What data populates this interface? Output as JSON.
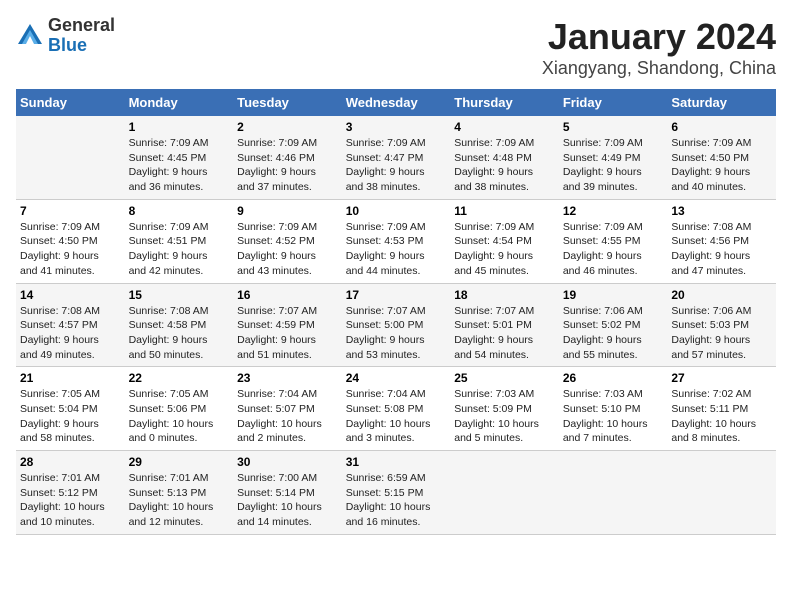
{
  "header": {
    "logo_general": "General",
    "logo_blue": "Blue",
    "title": "January 2024",
    "subtitle": "Xiangyang, Shandong, China"
  },
  "days_of_week": [
    "Sunday",
    "Monday",
    "Tuesday",
    "Wednesday",
    "Thursday",
    "Friday",
    "Saturday"
  ],
  "weeks": [
    [
      {
        "day": "",
        "info": ""
      },
      {
        "day": "1",
        "info": "Sunrise: 7:09 AM\nSunset: 4:45 PM\nDaylight: 9 hours\nand 36 minutes."
      },
      {
        "day": "2",
        "info": "Sunrise: 7:09 AM\nSunset: 4:46 PM\nDaylight: 9 hours\nand 37 minutes."
      },
      {
        "day": "3",
        "info": "Sunrise: 7:09 AM\nSunset: 4:47 PM\nDaylight: 9 hours\nand 38 minutes."
      },
      {
        "day": "4",
        "info": "Sunrise: 7:09 AM\nSunset: 4:48 PM\nDaylight: 9 hours\nand 38 minutes."
      },
      {
        "day": "5",
        "info": "Sunrise: 7:09 AM\nSunset: 4:49 PM\nDaylight: 9 hours\nand 39 minutes."
      },
      {
        "day": "6",
        "info": "Sunrise: 7:09 AM\nSunset: 4:50 PM\nDaylight: 9 hours\nand 40 minutes."
      }
    ],
    [
      {
        "day": "7",
        "info": "Sunrise: 7:09 AM\nSunset: 4:50 PM\nDaylight: 9 hours\nand 41 minutes."
      },
      {
        "day": "8",
        "info": "Sunrise: 7:09 AM\nSunset: 4:51 PM\nDaylight: 9 hours\nand 42 minutes."
      },
      {
        "day": "9",
        "info": "Sunrise: 7:09 AM\nSunset: 4:52 PM\nDaylight: 9 hours\nand 43 minutes."
      },
      {
        "day": "10",
        "info": "Sunrise: 7:09 AM\nSunset: 4:53 PM\nDaylight: 9 hours\nand 44 minutes."
      },
      {
        "day": "11",
        "info": "Sunrise: 7:09 AM\nSunset: 4:54 PM\nDaylight: 9 hours\nand 45 minutes."
      },
      {
        "day": "12",
        "info": "Sunrise: 7:09 AM\nSunset: 4:55 PM\nDaylight: 9 hours\nand 46 minutes."
      },
      {
        "day": "13",
        "info": "Sunrise: 7:08 AM\nSunset: 4:56 PM\nDaylight: 9 hours\nand 47 minutes."
      }
    ],
    [
      {
        "day": "14",
        "info": "Sunrise: 7:08 AM\nSunset: 4:57 PM\nDaylight: 9 hours\nand 49 minutes."
      },
      {
        "day": "15",
        "info": "Sunrise: 7:08 AM\nSunset: 4:58 PM\nDaylight: 9 hours\nand 50 minutes."
      },
      {
        "day": "16",
        "info": "Sunrise: 7:07 AM\nSunset: 4:59 PM\nDaylight: 9 hours\nand 51 minutes."
      },
      {
        "day": "17",
        "info": "Sunrise: 7:07 AM\nSunset: 5:00 PM\nDaylight: 9 hours\nand 53 minutes."
      },
      {
        "day": "18",
        "info": "Sunrise: 7:07 AM\nSunset: 5:01 PM\nDaylight: 9 hours\nand 54 minutes."
      },
      {
        "day": "19",
        "info": "Sunrise: 7:06 AM\nSunset: 5:02 PM\nDaylight: 9 hours\nand 55 minutes."
      },
      {
        "day": "20",
        "info": "Sunrise: 7:06 AM\nSunset: 5:03 PM\nDaylight: 9 hours\nand 57 minutes."
      }
    ],
    [
      {
        "day": "21",
        "info": "Sunrise: 7:05 AM\nSunset: 5:04 PM\nDaylight: 9 hours\nand 58 minutes."
      },
      {
        "day": "22",
        "info": "Sunrise: 7:05 AM\nSunset: 5:06 PM\nDaylight: 10 hours\nand 0 minutes."
      },
      {
        "day": "23",
        "info": "Sunrise: 7:04 AM\nSunset: 5:07 PM\nDaylight: 10 hours\nand 2 minutes."
      },
      {
        "day": "24",
        "info": "Sunrise: 7:04 AM\nSunset: 5:08 PM\nDaylight: 10 hours\nand 3 minutes."
      },
      {
        "day": "25",
        "info": "Sunrise: 7:03 AM\nSunset: 5:09 PM\nDaylight: 10 hours\nand 5 minutes."
      },
      {
        "day": "26",
        "info": "Sunrise: 7:03 AM\nSunset: 5:10 PM\nDaylight: 10 hours\nand 7 minutes."
      },
      {
        "day": "27",
        "info": "Sunrise: 7:02 AM\nSunset: 5:11 PM\nDaylight: 10 hours\nand 8 minutes."
      }
    ],
    [
      {
        "day": "28",
        "info": "Sunrise: 7:01 AM\nSunset: 5:12 PM\nDaylight: 10 hours\nand 10 minutes."
      },
      {
        "day": "29",
        "info": "Sunrise: 7:01 AM\nSunset: 5:13 PM\nDaylight: 10 hours\nand 12 minutes."
      },
      {
        "day": "30",
        "info": "Sunrise: 7:00 AM\nSunset: 5:14 PM\nDaylight: 10 hours\nand 14 minutes."
      },
      {
        "day": "31",
        "info": "Sunrise: 6:59 AM\nSunset: 5:15 PM\nDaylight: 10 hours\nand 16 minutes."
      },
      {
        "day": "",
        "info": ""
      },
      {
        "day": "",
        "info": ""
      },
      {
        "day": "",
        "info": ""
      }
    ]
  ]
}
